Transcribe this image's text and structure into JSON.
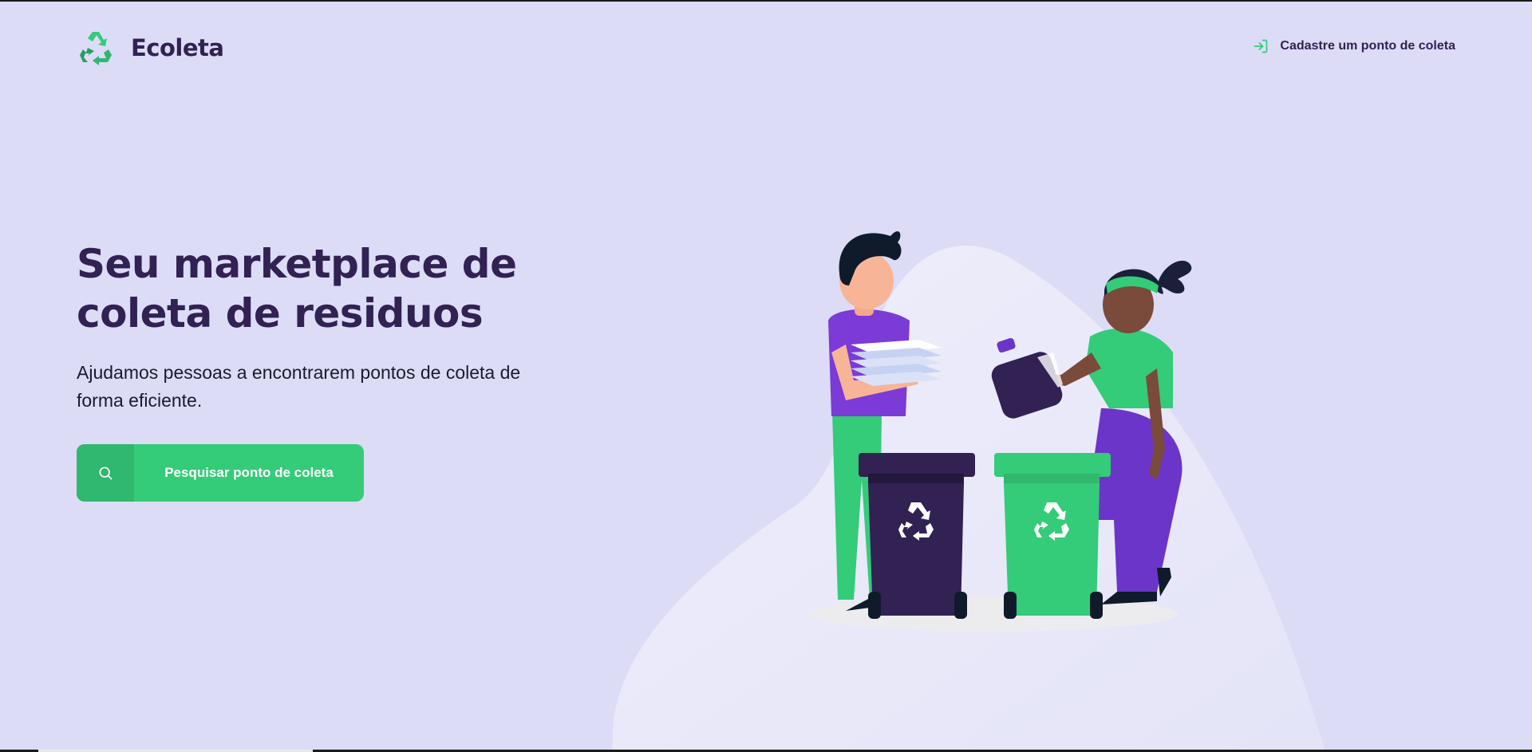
{
  "header": {
    "logo_text": "Ecoleta",
    "logo_icon": "recycle-icon",
    "register_link_label": "Cadastre um ponto de coleta",
    "register_icon": "log-in-icon"
  },
  "hero": {
    "title": "Seu marketplace de coleta de residuos",
    "subtitle": "Ajudamos pessoas a encontrarem pontos de coleta de forma eficiente.",
    "search_button_label": "Pesquisar ponto de coleta",
    "search_icon": "search-icon"
  },
  "colors": {
    "background": "#dcdcf7",
    "primary_green": "#34cb79",
    "dark_green": "#2fb86e",
    "title_color": "#322153",
    "purple": "#6c35c9"
  }
}
